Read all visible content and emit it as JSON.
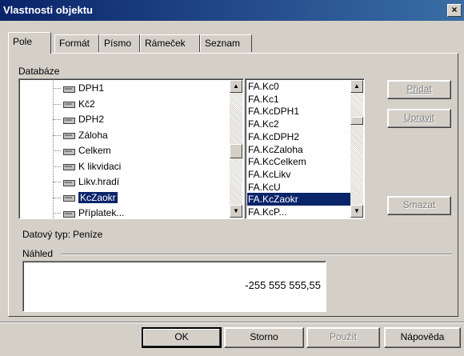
{
  "window": {
    "title": "Vlastnosti objektu",
    "close_label": "×"
  },
  "tabs": [
    {
      "label": "Pole",
      "active": true
    },
    {
      "label": "Formát",
      "active": false
    },
    {
      "label": "Písmo",
      "active": false
    },
    {
      "label": "Rámeček",
      "active": false
    },
    {
      "label": "Seznam",
      "active": false
    }
  ],
  "pole": {
    "database_label": "Databáze",
    "tree_items": [
      "DPH1",
      "Kč2",
      "DPH2",
      "Záloha",
      "Celkem",
      "K likvidaci",
      "Likv.hradí",
      "KcZaokr",
      "Příplatek..."
    ],
    "tree_selected": "KcZaokr",
    "fields": [
      "FA.Kc0",
      "FA.Kc1",
      "FA.KcDPH1",
      "FA.Kc2",
      "FA.KcDPH2",
      "FA.KcZaloha",
      "FA.KcCelkem",
      "FA.KcLikv",
      "FA.KcU",
      "FA.KcZaokr",
      "FA.KcP..."
    ],
    "field_selected": "FA.KcZaokr",
    "buttons": {
      "add": "Přidat",
      "edit": "Upravit",
      "delete": "Smazat"
    },
    "datatype_label": "Datový typ:",
    "datatype_value": "Peníze",
    "preview_label": "Náhled",
    "preview_value": "-255 555 555,55"
  },
  "footer": {
    "ok": "OK",
    "cancel": "Storno",
    "apply": "Použít",
    "help": "Nápověda"
  },
  "colors": {
    "titlebar": "#0a246a",
    "face": "#d4d0c8",
    "selection": "#0a246a"
  }
}
